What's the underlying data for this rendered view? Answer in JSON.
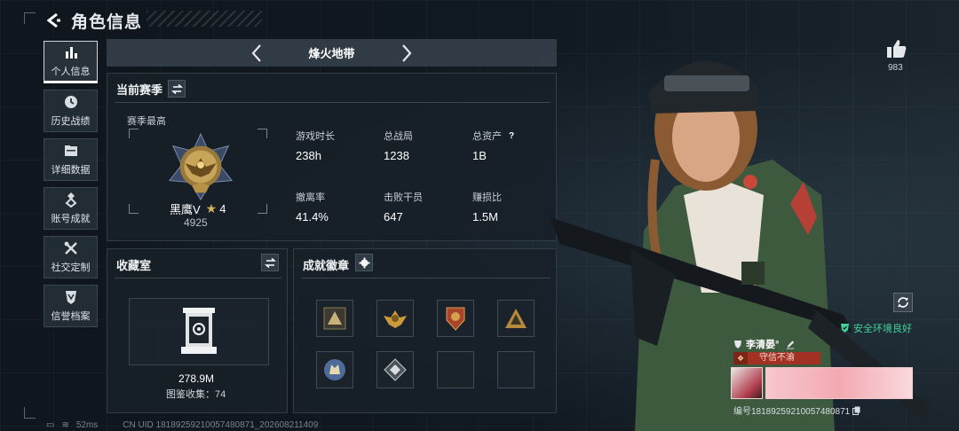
{
  "header": {
    "title": "角色信息"
  },
  "sidebar": {
    "items": [
      {
        "label": "个人信息",
        "icon": "bar-chart-icon",
        "active": true
      },
      {
        "label": "历史战绩",
        "icon": "clock-icon",
        "active": false
      },
      {
        "label": "详细数据",
        "icon": "folder-icon",
        "active": false
      },
      {
        "label": "账号成就",
        "icon": "medal-icon",
        "active": false
      },
      {
        "label": "社交定制",
        "icon": "tools-icon",
        "active": false
      },
      {
        "label": "信誉档案",
        "icon": "shield-emblem-icon",
        "active": false
      }
    ]
  },
  "season": {
    "name": "烽火地带"
  },
  "current_season": {
    "title": "当前赛季",
    "rank_label": "赛季最高",
    "rank_name": "黑鹰V",
    "rank_stars": "4",
    "rank_score": "4925",
    "stats": [
      {
        "label": "游戏时长",
        "value": "238h"
      },
      {
        "label": "总战局",
        "value": "1238"
      },
      {
        "label": "总资产",
        "value": "1B",
        "help": "?"
      },
      {
        "label": "撤离率",
        "value": "41.4%"
      },
      {
        "label": "击败干员",
        "value": "647"
      },
      {
        "label": "赚损比",
        "value": "1.5M"
      }
    ]
  },
  "collection": {
    "title": "收藏室",
    "value": "278.9M",
    "count_text": "图鉴收集：74"
  },
  "achievements": {
    "title": "成就徽章",
    "slots": [
      "badge-triangle",
      "badge-eagle",
      "badge-shield",
      "badge-mountain",
      "badge-wolf",
      "badge-diamond",
      "",
      ""
    ]
  },
  "profile": {
    "likes": "983",
    "safe_status": "安全环境良好",
    "player_name": "李清晏°",
    "reputation": "守信不渝",
    "id_text": "编号18189259210057480871"
  },
  "footer": {
    "ping": "52ms",
    "uid": "CN UID 18189259210057480871_202608211409"
  },
  "colors": {
    "accent_green": "#42d39a",
    "reputation_red": "#a23124",
    "rank_gold": "#d6b654"
  }
}
